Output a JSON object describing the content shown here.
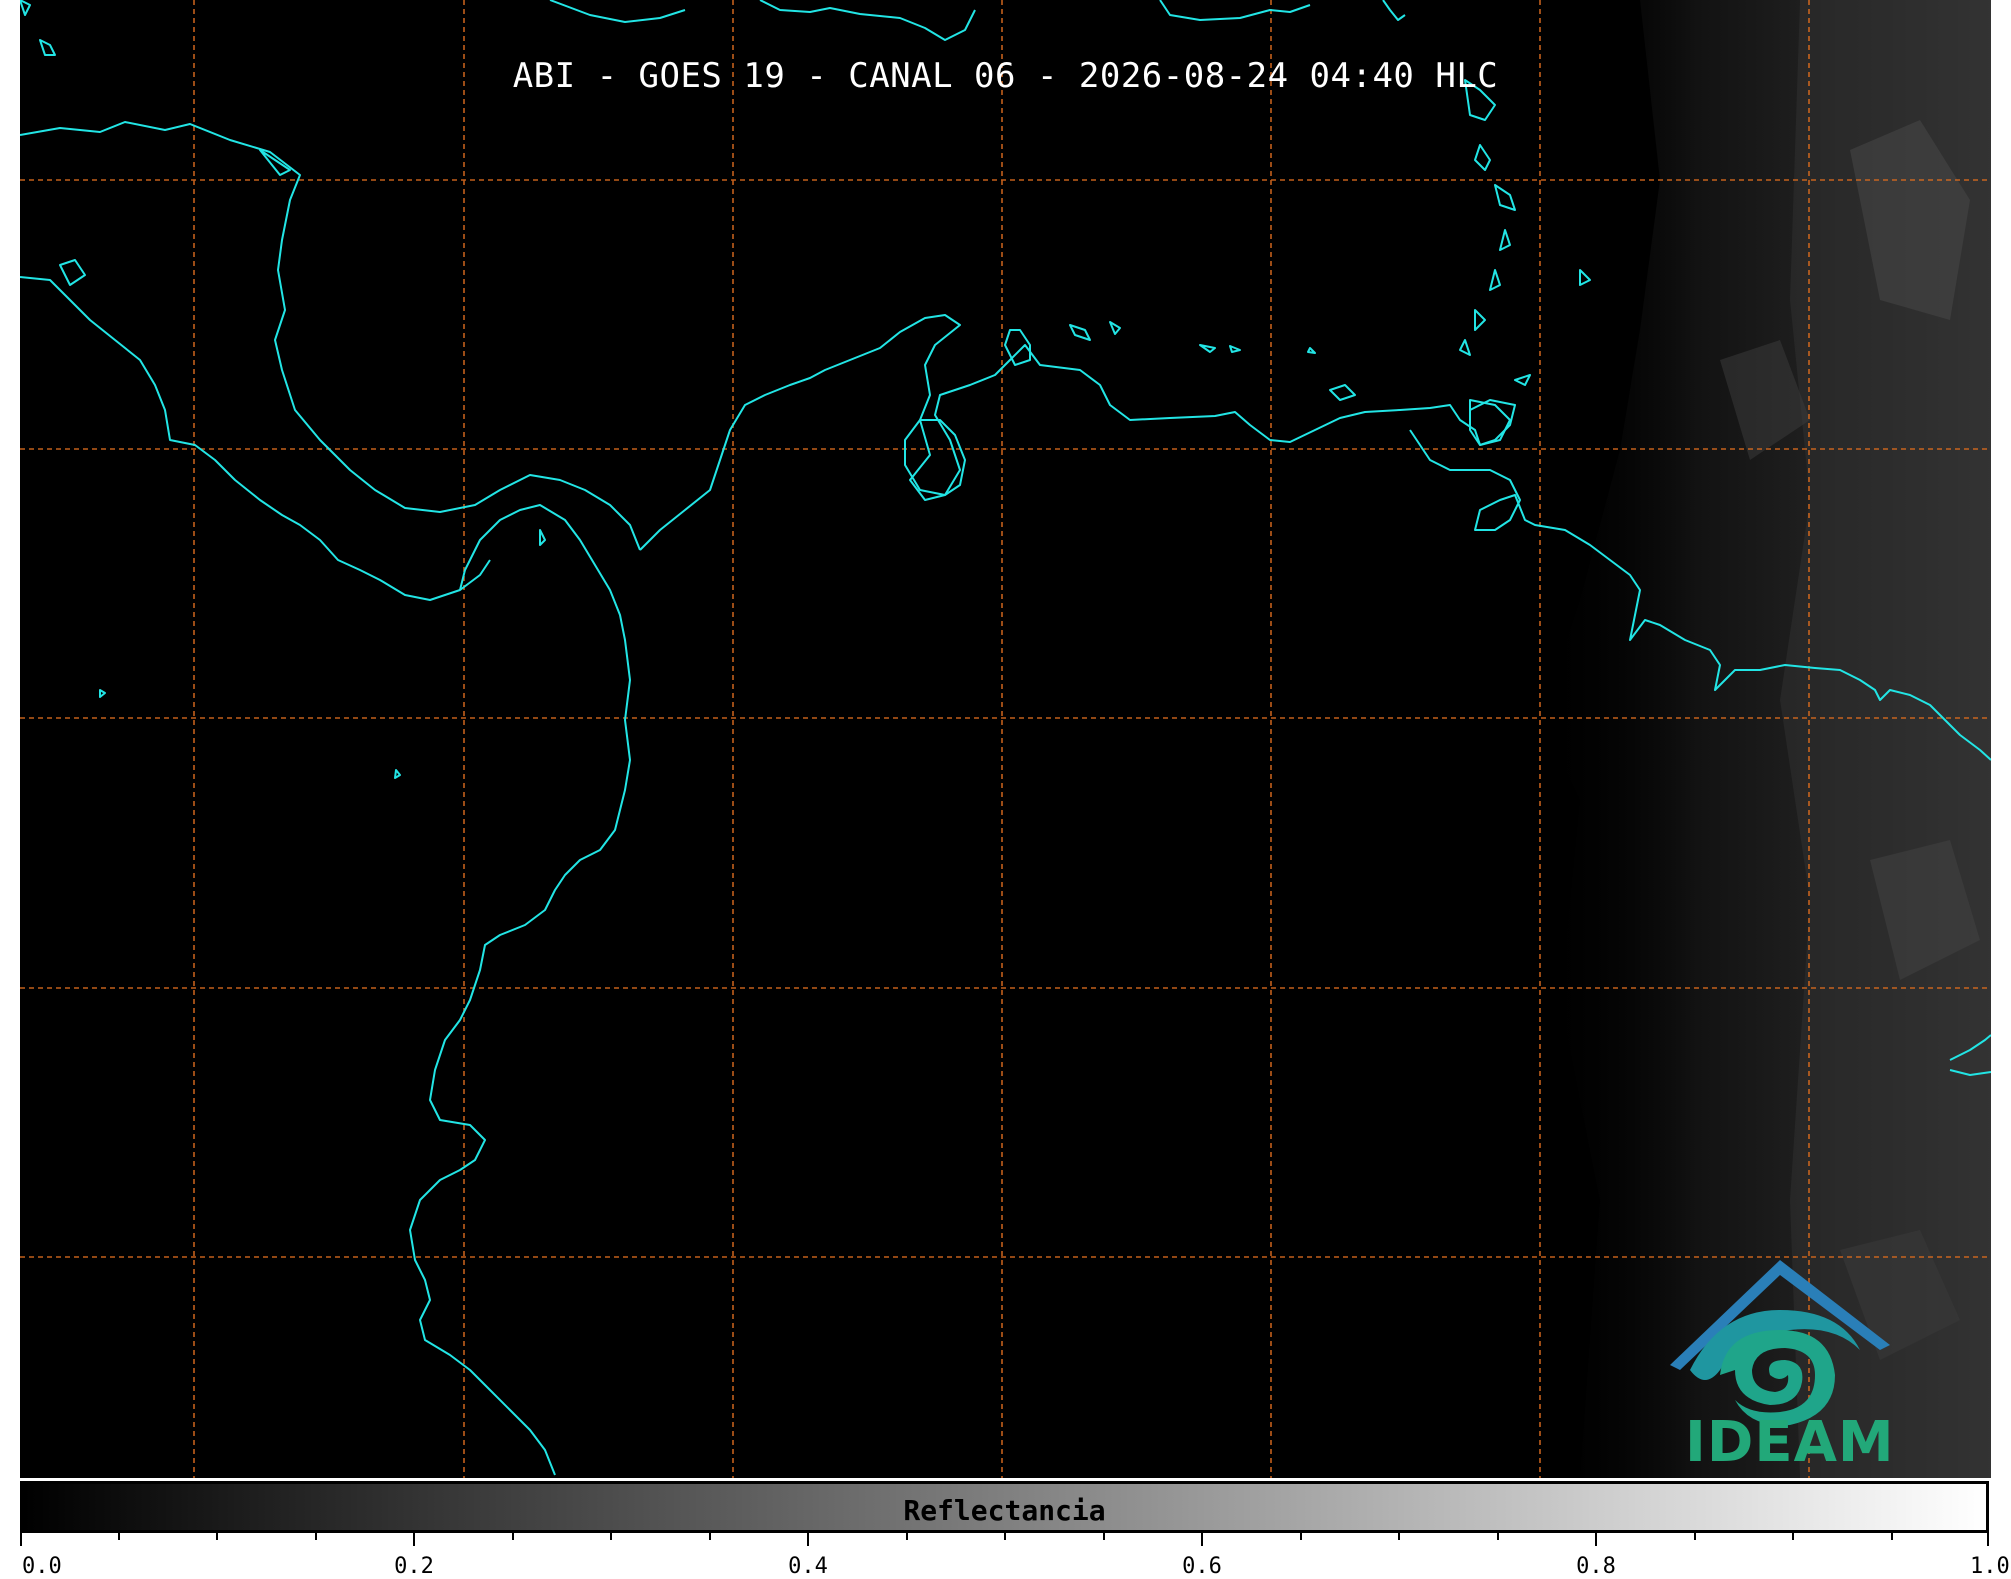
{
  "map": {
    "title": "ABI - GOES 19 - CANAL 06 - 2026-08-24 04:40 HLC",
    "background_color": "#000000",
    "coastline_color": "#22e5e5",
    "gridline_color": "#d86a1e",
    "gridline_style": "dashed"
  },
  "logo": {
    "text": "IDEAM",
    "icon": "ideam-logo-icon",
    "colors": {
      "roof": "#2a7fb8",
      "swirl": "#1fa58a",
      "text": "#22a879"
    }
  },
  "colorbar": {
    "label": "Reflectancia",
    "colormap": "grayscale",
    "range": [
      0.0,
      1.0
    ],
    "tick_labels": [
      "0.0",
      "0.2",
      "0.4",
      "0.6",
      "0.8",
      "1.0"
    ]
  }
}
